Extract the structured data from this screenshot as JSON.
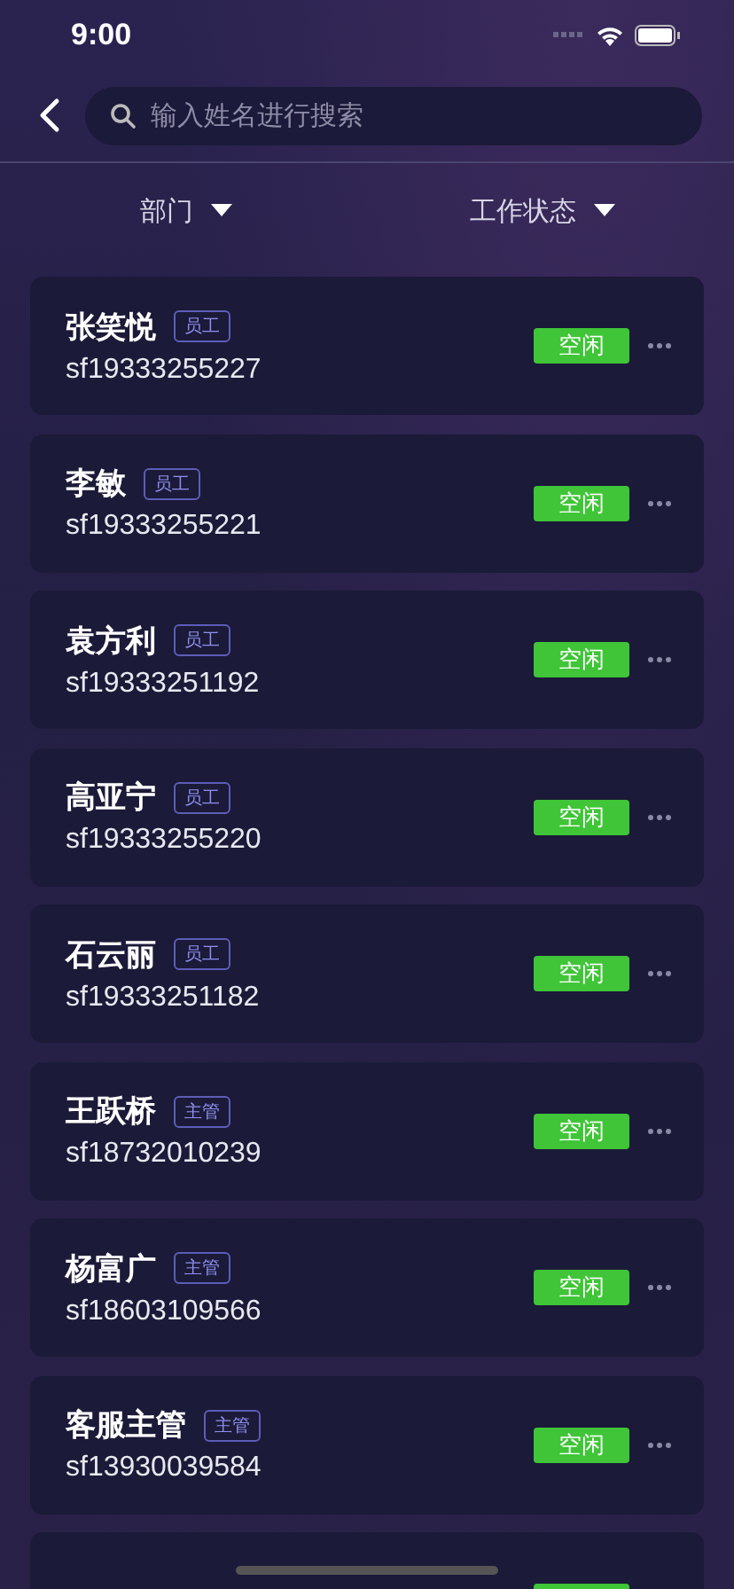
{
  "status_bar": {
    "time": "9:00"
  },
  "search": {
    "placeholder": "输入姓名进行搜索"
  },
  "filters": [
    {
      "label": "部门"
    },
    {
      "label": "工作状态"
    }
  ],
  "employees": [
    {
      "name": "张笑悦",
      "role": "员工",
      "account": "sf19333255227",
      "status": "空闲"
    },
    {
      "name": "李敏",
      "role": "员工",
      "account": "sf19333255221",
      "status": "空闲"
    },
    {
      "name": "袁方利",
      "role": "员工",
      "account": "sf19333251192",
      "status": "空闲"
    },
    {
      "name": "高亚宁",
      "role": "员工",
      "account": "sf19333255220",
      "status": "空闲"
    },
    {
      "name": "石云丽",
      "role": "员工",
      "account": "sf19333251182",
      "status": "空闲"
    },
    {
      "name": "王跃桥",
      "role": "主管",
      "account": "sf18732010239",
      "status": "空闲"
    },
    {
      "name": "杨富广",
      "role": "主管",
      "account": "sf18603109566",
      "status": "空闲"
    },
    {
      "name": "客服主管",
      "role": "主管",
      "account": "sf13930039584",
      "status": "空闲"
    },
    {
      "kind": "partial"
    }
  ]
}
